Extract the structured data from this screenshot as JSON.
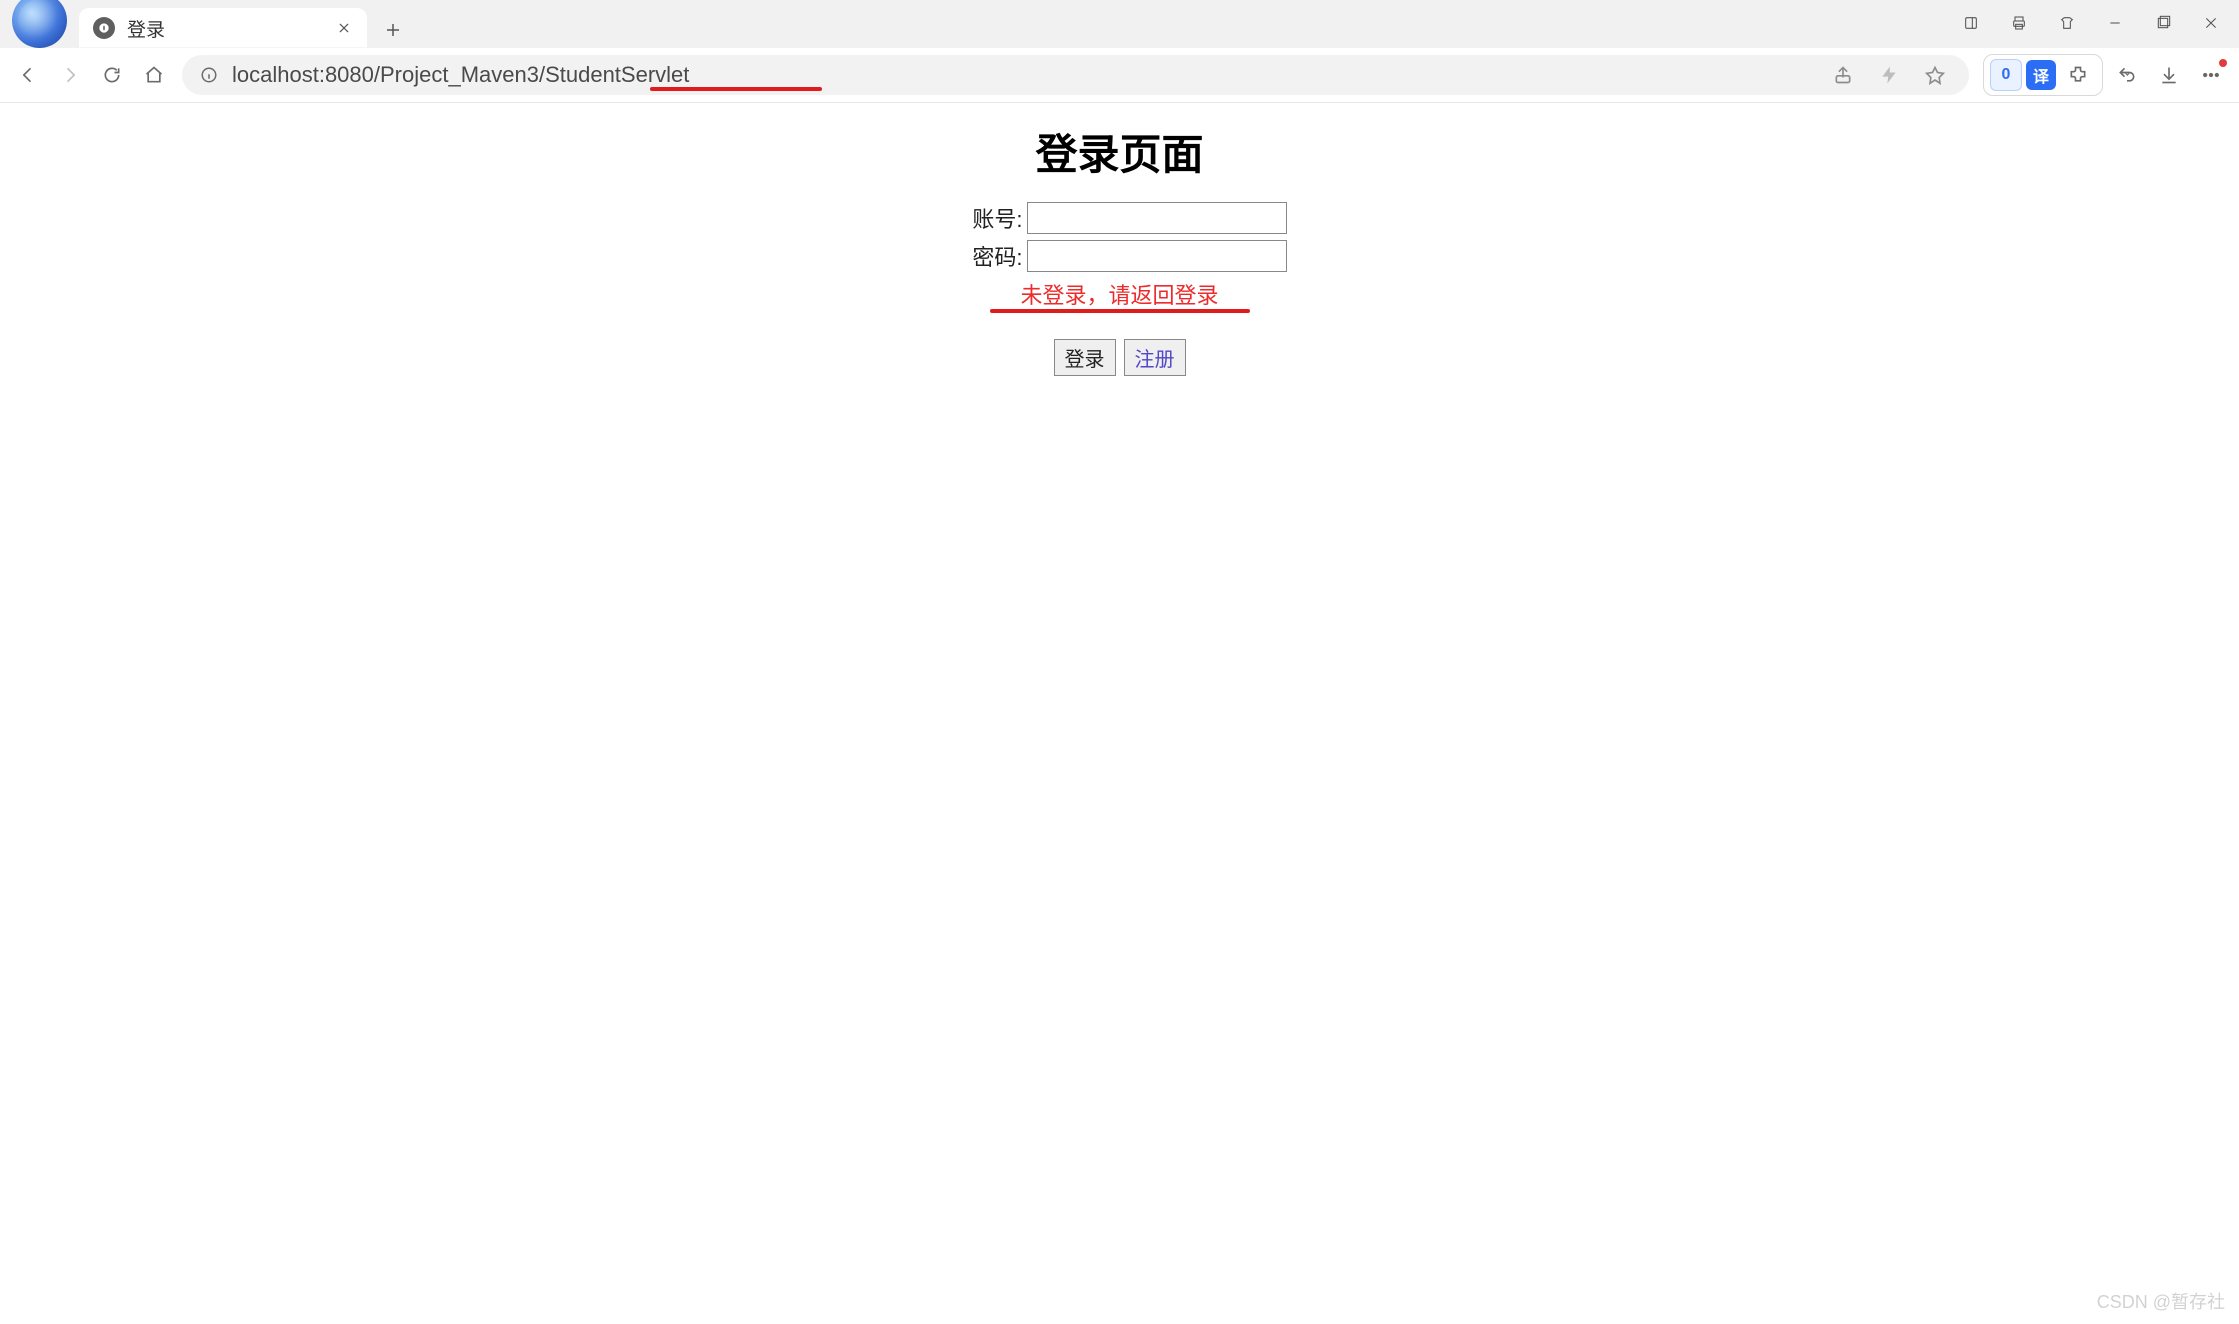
{
  "browser": {
    "tab_title": "登录",
    "url": "localhost:8080/Project_Maven3/StudentServlet"
  },
  "extensions": {
    "zero_label": "0",
    "translate_label": "译"
  },
  "page": {
    "heading": "登录页面",
    "username_label": "账号:",
    "password_label": "密码:",
    "username_value": "",
    "password_value": "",
    "error_message": "未登录，请返回登录",
    "login_button": "登录",
    "register_button": "注册"
  },
  "watermark": "CSDN @暂存社"
}
